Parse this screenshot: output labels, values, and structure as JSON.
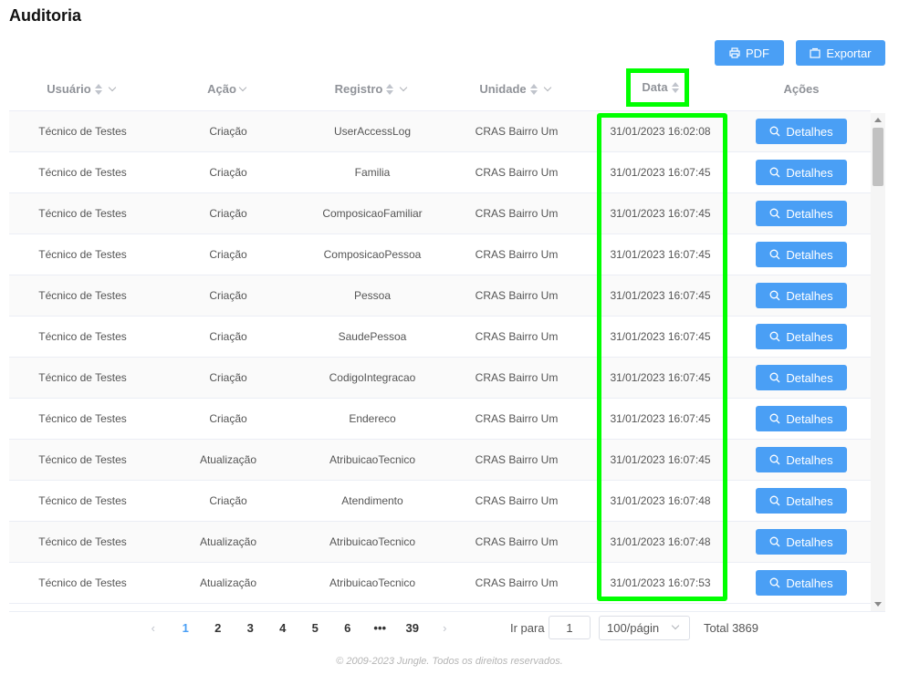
{
  "page": {
    "title": "Auditoria"
  },
  "toolbar": {
    "pdf_label": "PDF",
    "export_label": "Exportar"
  },
  "table": {
    "headers": {
      "usuario": "Usuário",
      "acao": "Ação",
      "registro": "Registro",
      "unidade": "Unidade",
      "data": "Data",
      "acoes": "Ações"
    },
    "details_label": "Detalhes",
    "rows": [
      {
        "usuario": "Técnico de Testes",
        "acao": "Criação",
        "registro": "UserAccessLog",
        "unidade": "CRAS Bairro Um",
        "data": "31/01/2023 16:02:08"
      },
      {
        "usuario": "Técnico de Testes",
        "acao": "Criação",
        "registro": "Familia",
        "unidade": "CRAS Bairro Um",
        "data": "31/01/2023 16:07:45"
      },
      {
        "usuario": "Técnico de Testes",
        "acao": "Criação",
        "registro": "ComposicaoFamiliar",
        "unidade": "CRAS Bairro Um",
        "data": "31/01/2023 16:07:45"
      },
      {
        "usuario": "Técnico de Testes",
        "acao": "Criação",
        "registro": "ComposicaoPessoa",
        "unidade": "CRAS Bairro Um",
        "data": "31/01/2023 16:07:45"
      },
      {
        "usuario": "Técnico de Testes",
        "acao": "Criação",
        "registro": "Pessoa",
        "unidade": "CRAS Bairro Um",
        "data": "31/01/2023 16:07:45"
      },
      {
        "usuario": "Técnico de Testes",
        "acao": "Criação",
        "registro": "SaudePessoa",
        "unidade": "CRAS Bairro Um",
        "data": "31/01/2023 16:07:45"
      },
      {
        "usuario": "Técnico de Testes",
        "acao": "Criação",
        "registro": "CodigoIntegracao",
        "unidade": "CRAS Bairro Um",
        "data": "31/01/2023 16:07:45"
      },
      {
        "usuario": "Técnico de Testes",
        "acao": "Criação",
        "registro": "Endereco",
        "unidade": "CRAS Bairro Um",
        "data": "31/01/2023 16:07:45"
      },
      {
        "usuario": "Técnico de Testes",
        "acao": "Atualização",
        "registro": "AtribuicaoTecnico",
        "unidade": "CRAS Bairro Um",
        "data": "31/01/2023 16:07:45"
      },
      {
        "usuario": "Técnico de Testes",
        "acao": "Criação",
        "registro": "Atendimento",
        "unidade": "CRAS Bairro Um",
        "data": "31/01/2023 16:07:48"
      },
      {
        "usuario": "Técnico de Testes",
        "acao": "Atualização",
        "registro": "AtribuicaoTecnico",
        "unidade": "CRAS Bairro Um",
        "data": "31/01/2023 16:07:48"
      },
      {
        "usuario": "Técnico de Testes",
        "acao": "Atualização",
        "registro": "AtribuicaoTecnico",
        "unidade": "CRAS Bairro Um",
        "data": "31/01/2023 16:07:53"
      }
    ]
  },
  "pagination": {
    "prev_icon": "chevron-left-icon",
    "next_icon": "chevron-right-icon",
    "pages": [
      "1",
      "2",
      "3",
      "4",
      "5",
      "6",
      "•••",
      "39"
    ],
    "current_page": "1",
    "goto_label": "Ir para",
    "goto_value": "1",
    "page_size": "100/págin",
    "total": "Total 3869"
  },
  "footer": {
    "copyright": "© 2009-2023 Jungle. Todos os direitos reservados."
  },
  "colors": {
    "primary": "#4a9ff5",
    "highlight": "#00ff00"
  }
}
